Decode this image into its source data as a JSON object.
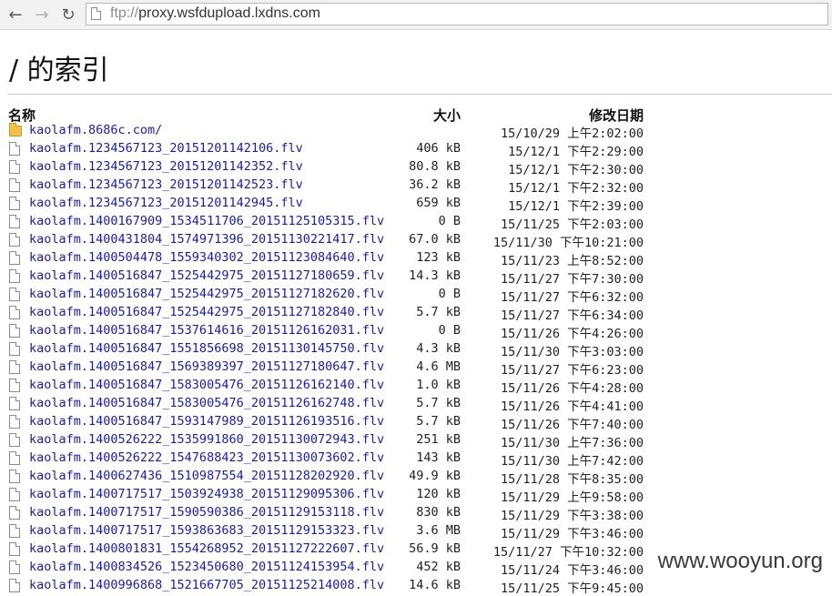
{
  "browser": {
    "back_glyph": "←",
    "forward_glyph": "→",
    "reload_glyph": "↻",
    "url_scheme": "ftp://",
    "url_host": "proxy.wsfdupload.lxdns.com"
  },
  "page": {
    "heading": "/ 的索引",
    "columns": {
      "name": "名称",
      "size": "大小",
      "modified": "修改日期"
    }
  },
  "entries": [
    {
      "type": "folder",
      "name": "kaolafm.8686c.com/",
      "size": "",
      "date": "15/10/29 上午2:02:00"
    },
    {
      "type": "file",
      "name": "kaolafm.1234567123_20151201142106.flv",
      "size": "406 kB",
      "date": "15/12/1 下午2:29:00"
    },
    {
      "type": "file",
      "name": "kaolafm.1234567123_20151201142352.flv",
      "size": "80.8 kB",
      "date": "15/12/1 下午2:30:00"
    },
    {
      "type": "file",
      "name": "kaolafm.1234567123_20151201142523.flv",
      "size": "36.2 kB",
      "date": "15/12/1 下午2:32:00"
    },
    {
      "type": "file",
      "name": "kaolafm.1234567123_20151201142945.flv",
      "size": "659 kB",
      "date": "15/12/1 下午2:39:00"
    },
    {
      "type": "file",
      "name": "kaolafm.1400167909_1534511706_20151125105315.flv",
      "size": "0 B",
      "date": "15/11/25 下午2:03:00"
    },
    {
      "type": "file",
      "name": "kaolafm.1400431804_1574971396_20151130221417.flv",
      "size": "67.0 kB",
      "date": "15/11/30 下午10:21:00"
    },
    {
      "type": "file",
      "name": "kaolafm.1400504478_1559340302_20151123084640.flv",
      "size": "123 kB",
      "date": "15/11/23 上午8:52:00"
    },
    {
      "type": "file",
      "name": "kaolafm.1400516847_1525442975_20151127180659.flv",
      "size": "14.3 kB",
      "date": "15/11/27 下午7:30:00"
    },
    {
      "type": "file",
      "name": "kaolafm.1400516847_1525442975_20151127182620.flv",
      "size": "0 B",
      "date": "15/11/27 下午6:32:00"
    },
    {
      "type": "file",
      "name": "kaolafm.1400516847_1525442975_20151127182840.flv",
      "size": "5.7 kB",
      "date": "15/11/27 下午6:34:00"
    },
    {
      "type": "file",
      "name": "kaolafm.1400516847_1537614616_20151126162031.flv",
      "size": "0 B",
      "date": "15/11/26 下午4:26:00"
    },
    {
      "type": "file",
      "name": "kaolafm.1400516847_1551856698_20151130145750.flv",
      "size": "4.3 kB",
      "date": "15/11/30 下午3:03:00"
    },
    {
      "type": "file",
      "name": "kaolafm.1400516847_1569389397_20151127180647.flv",
      "size": "4.6 MB",
      "date": "15/11/27 下午6:23:00"
    },
    {
      "type": "file",
      "name": "kaolafm.1400516847_1583005476_20151126162140.flv",
      "size": "1.0 kB",
      "date": "15/11/26 下午4:28:00"
    },
    {
      "type": "file",
      "name": "kaolafm.1400516847_1583005476_20151126162748.flv",
      "size": "5.7 kB",
      "date": "15/11/26 下午4:41:00"
    },
    {
      "type": "file",
      "name": "kaolafm.1400516847_1593147989_20151126193516.flv",
      "size": "5.7 kB",
      "date": "15/11/26 下午7:40:00"
    },
    {
      "type": "file",
      "name": "kaolafm.1400526222_1535991860_20151130072943.flv",
      "size": "251 kB",
      "date": "15/11/30 上午7:36:00"
    },
    {
      "type": "file",
      "name": "kaolafm.1400526222_1547688423_20151130073602.flv",
      "size": "143 kB",
      "date": "15/11/30 上午7:42:00"
    },
    {
      "type": "file",
      "name": "kaolafm.1400627436_1510987554_20151128202920.flv",
      "size": "49.9 kB",
      "date": "15/11/28 下午8:35:00"
    },
    {
      "type": "file",
      "name": "kaolafm.1400717517_1503924938_20151129095306.flv",
      "size": "120 kB",
      "date": "15/11/29 上午9:58:00"
    },
    {
      "type": "file",
      "name": "kaolafm.1400717517_1590590386_20151129153118.flv",
      "size": "830 kB",
      "date": "15/11/29 下午3:38:00"
    },
    {
      "type": "file",
      "name": "kaolafm.1400717517_1593863683_20151129153323.flv",
      "size": "3.6 MB",
      "date": "15/11/29 下午3:46:00"
    },
    {
      "type": "file",
      "name": "kaolafm.1400801831_1554268952_20151127222607.flv",
      "size": "56.9 kB",
      "date": "15/11/27 下午10:32:00"
    },
    {
      "type": "file",
      "name": "kaolafm.1400834526_1523450680_20151124153954.flv",
      "size": "452 kB",
      "date": "15/11/24 下午3:46:00"
    },
    {
      "type": "file",
      "name": "kaolafm.1400996868_1521667705_20151125214008.flv",
      "size": "14.6 kB",
      "date": "15/11/25 下午9:45:00"
    }
  ],
  "watermark": "www.wooyun.org"
}
